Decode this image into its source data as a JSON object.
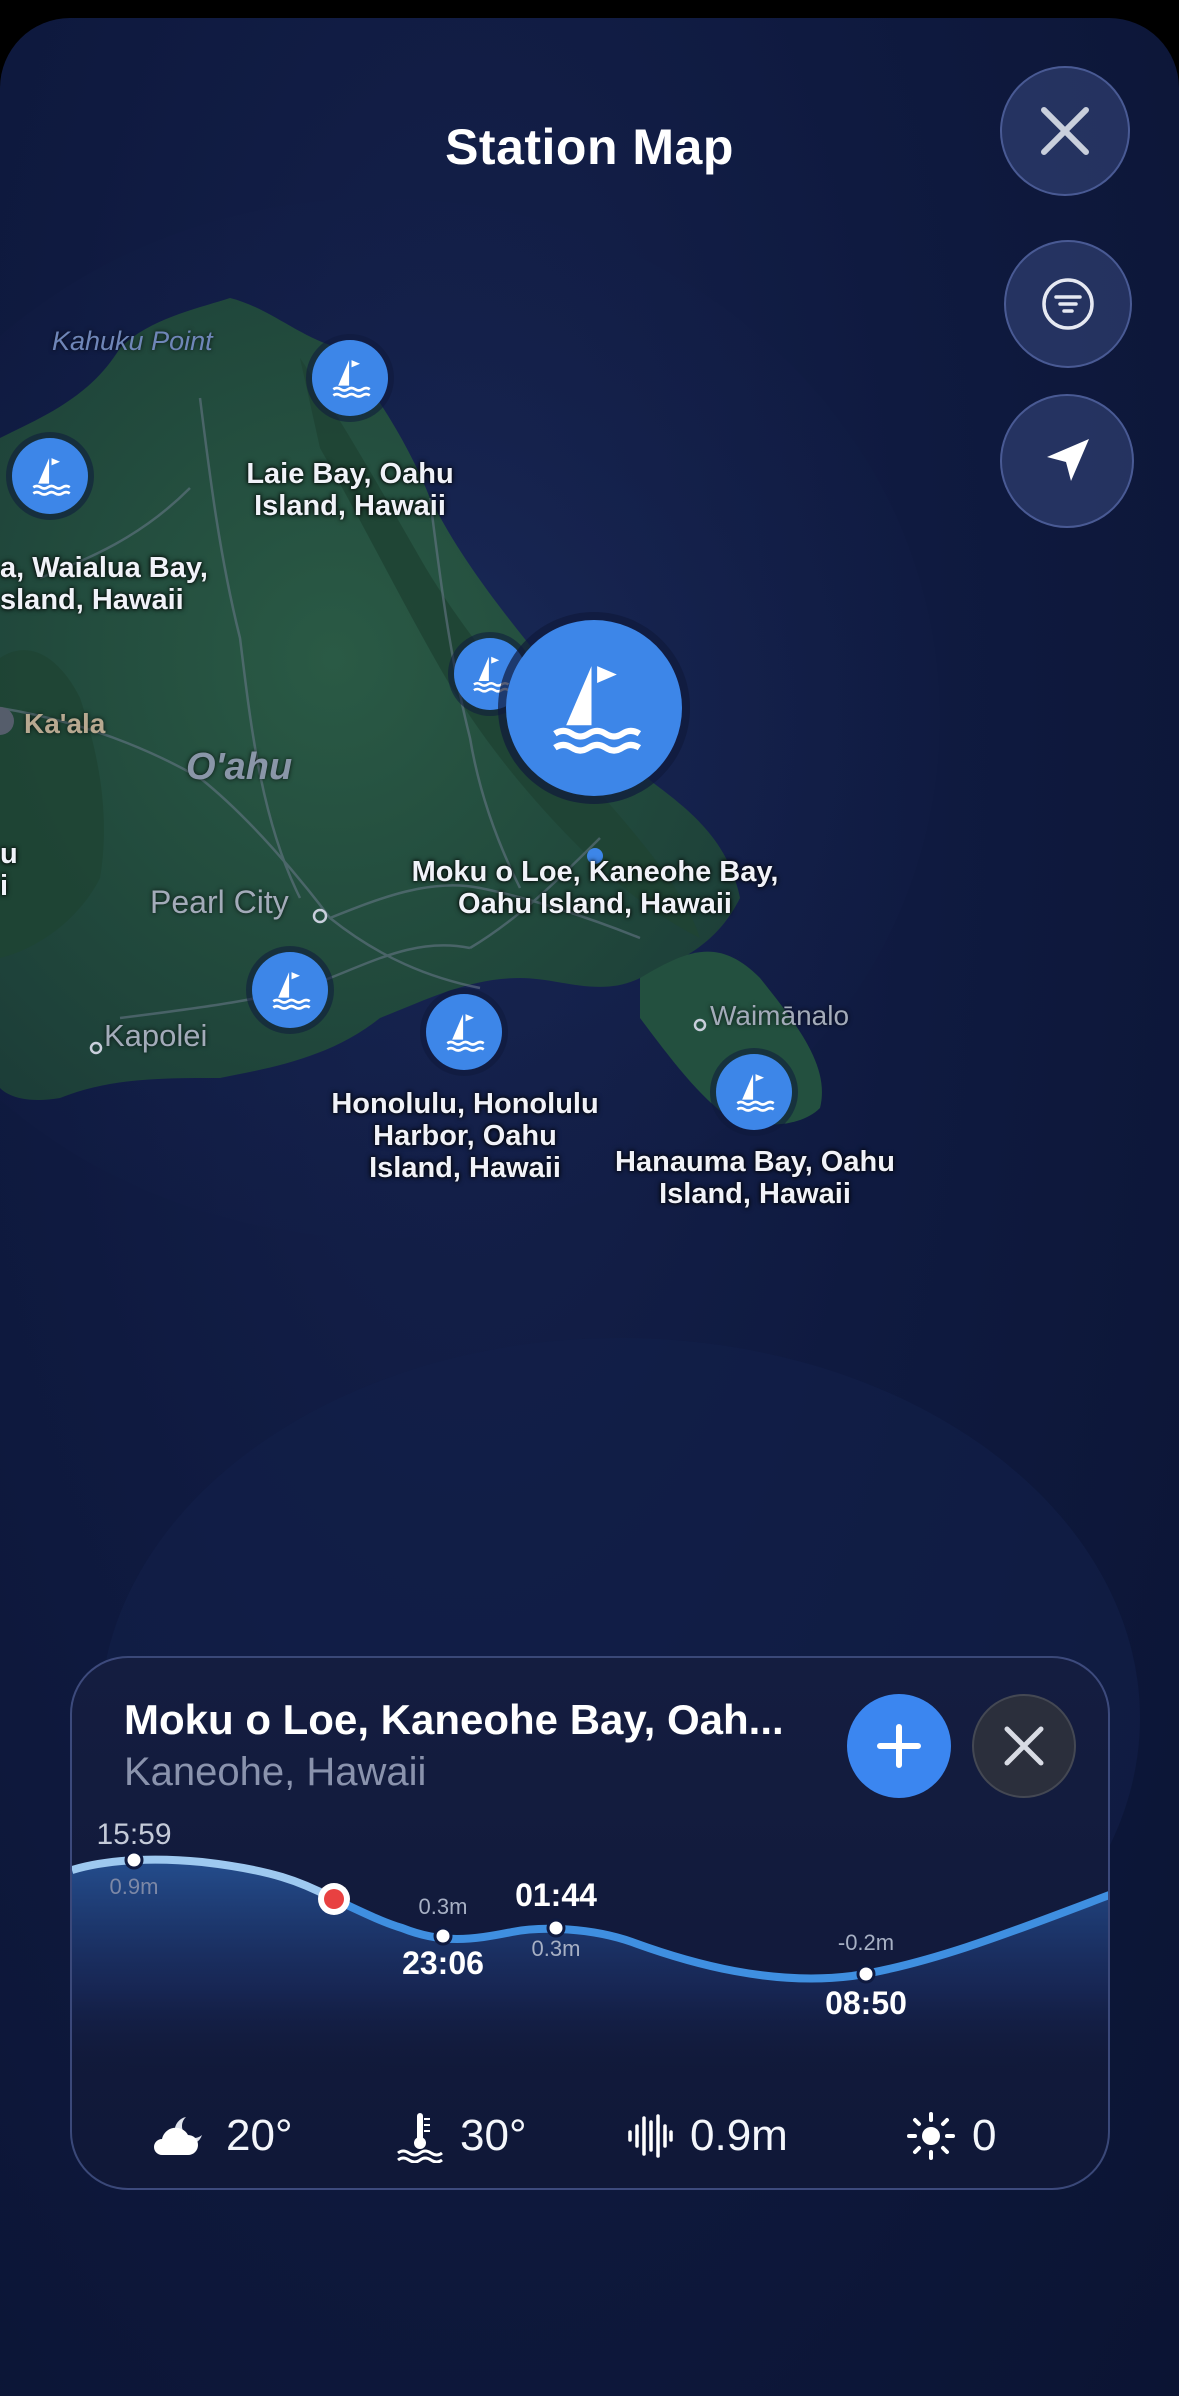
{
  "header": {
    "title": "Station Map"
  },
  "map": {
    "places": {
      "kahuku_point": "Kahuku Point",
      "oahu": "O'ahu",
      "kaala": "Ka'ala",
      "pearl_city": "Pearl City",
      "kapolei": "Kapolei",
      "waimanalo": "Waimānalo"
    },
    "stations": [
      {
        "label": "Laie Bay, Oahu Island, Hawaii"
      },
      {
        "label": "a, Waialua Bay, sland, Hawaii"
      },
      {
        "label": "Moku o Loe, Kaneohe Bay, Oahu Island, Hawaii"
      },
      {
        "label": "Honolulu, Honolulu Harbor, Oahu Island, Hawaii"
      },
      {
        "label": "Hanauma Bay, Oahu Island, Hawaii"
      }
    ],
    "station_label_lines": {
      "laie": [
        "Laie Bay, Oahu",
        "Island, Hawaii"
      ],
      "waialua": [
        "a, Waialua Bay,",
        "sland, Hawaii"
      ],
      "moku": [
        "Moku o Loe, Kaneohe Bay,",
        "Oahu Island, Hawaii"
      ],
      "honolulu": [
        "Honolulu, Honolulu",
        "Harbor, Oahu",
        "Island, Hawaii"
      ],
      "hanauma": [
        "Hanauma Bay, Oahu",
        "Island, Hawaii"
      ],
      "left_edge": [
        "u",
        "i"
      ]
    }
  },
  "card": {
    "title": "Moku o Loe, Kaneohe Bay, Oah...",
    "subtitle": "Kaneohe, Hawaii",
    "tide": {
      "points": [
        {
          "time": "15:59",
          "height": "0.9m",
          "type": "high"
        },
        {
          "time": "23:06",
          "height": "0.3m",
          "type": "low"
        },
        {
          "time": "01:44",
          "height": "0.3m",
          "type": "high"
        },
        {
          "time": "08:50",
          "height": "-0.2m",
          "type": "low"
        }
      ]
    },
    "stats": {
      "air_temp": "20°",
      "water_temp": "30°",
      "wave_height": "0.9m",
      "uv_index": "0"
    }
  },
  "colors": {
    "accent": "#3b86f0",
    "pin": "#3d86e8",
    "now_marker": "#e84141",
    "background": "#0f1a40"
  }
}
